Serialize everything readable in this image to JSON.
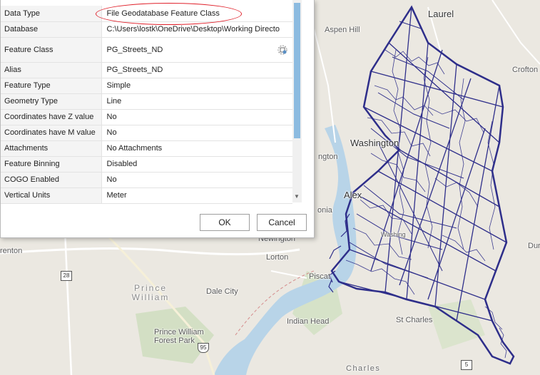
{
  "dialog": {
    "properties": [
      {
        "label": "Data Type",
        "value": "File Geodatabase Feature Class"
      },
      {
        "label": "Database",
        "value": "C:\\Users\\lostk\\OneDrive\\Desktop\\Working Directo"
      },
      {
        "label": "Feature Class",
        "value": "PG_Streets_ND"
      },
      {
        "label": "Alias",
        "value": "PG_Streets_ND"
      },
      {
        "label": "Feature Type",
        "value": "Simple"
      },
      {
        "label": "Geometry Type",
        "value": "Line"
      },
      {
        "label": "Coordinates have Z value",
        "value": "No"
      },
      {
        "label": "Coordinates have M value",
        "value": "No"
      },
      {
        "label": "Attachments",
        "value": "No Attachments"
      },
      {
        "label": "Feature Binning",
        "value": "Disabled"
      },
      {
        "label": "COGO Enabled",
        "value": "No"
      },
      {
        "label": "Vertical Units",
        "value": "Meter"
      }
    ],
    "ok_label": "OK",
    "cancel_label": "Cancel",
    "catalog_icon": "catalog-icon",
    "annotation_color": "#e0202a"
  },
  "map": {
    "labels": {
      "laurel": "Laurel",
      "aspen_hill": "Aspen Hill",
      "crofton": "Crofton",
      "washington": "Washington",
      "alex": "Alex",
      "onia": "onia",
      "ngton": "ngton",
      "newington": "Newington",
      "lorton": "Lorton",
      "renton": "renton",
      "prince_william": "Prince William",
      "dale_city": "Dale City",
      "piscat": "Piscat",
      "indian_head": "Indian Head",
      "st_charles": "St Charles",
      "pw_forest_park": "Prince William Forest Park",
      "charles": "Charles",
      "dur": "Dur",
      "washing_small": "Washing"
    },
    "shields": {
      "r28": "28",
      "i95": "95",
      "r5": "5"
    },
    "network_color": "#2e2e8a"
  }
}
